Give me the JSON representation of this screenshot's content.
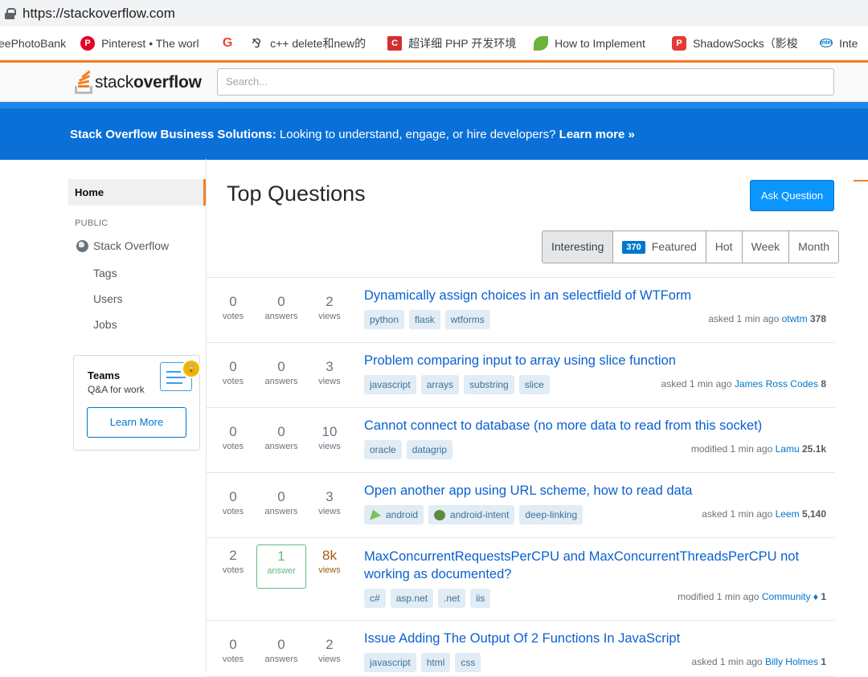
{
  "browser": {
    "url": "https://stackoverflow.com",
    "bookmarks": [
      {
        "icon": "photobank-icon",
        "label": "eePhotoBank",
        "width": 80
      },
      {
        "icon": "pinterest-icon",
        "label": "Pinterest • The worl",
        "width": 130
      },
      {
        "icon": "google-icon",
        "label": "",
        "width": 0
      },
      {
        "icon": "cpp-icon",
        "label": "c++ delete和new的",
        "width": 128
      },
      {
        "icon": "csdn-icon",
        "label": "超详细 PHP 开发环境",
        "width": 138
      },
      {
        "icon": "leaf-icon",
        "label": "How to Implement",
        "width": 128
      },
      {
        "icon": "p-icon",
        "label": "ShadowSocks（影梭",
        "width": 140
      },
      {
        "icon": "intel-icon",
        "label": "Inte",
        "width": 30
      }
    ]
  },
  "header": {
    "logo_text_light": "stack",
    "logo_text_bold": "overflow",
    "search_placeholder": "Search..."
  },
  "banner": {
    "bold": "Stack Overflow Business Solutions:",
    "text": " Looking to understand, engage, or hire developers? ",
    "link": "Learn more »"
  },
  "leftnav": {
    "home": "Home",
    "public": "PUBLIC",
    "stack_overflow": "Stack Overflow",
    "tags": "Tags",
    "users": "Users",
    "jobs": "Jobs"
  },
  "teams": {
    "title": "Teams",
    "subtitle": "Q&A for work",
    "button": "Learn More"
  },
  "main": {
    "title": "Top Questions",
    "ask_button": "Ask Question",
    "filters": {
      "interesting": "Interesting",
      "featured_count": "370",
      "featured": "Featured",
      "hot": "Hot",
      "week": "Week",
      "month": "Month"
    }
  },
  "questions": [
    {
      "votes": "0",
      "answers": "0",
      "views": "2",
      "answers_label": "answers",
      "title": "Dynamically assign choices in an selectfield of WTForm",
      "tags": [
        "python",
        "flask",
        "wtforms"
      ],
      "action": "asked 1 min ago",
      "user": "otwtm",
      "rep": "378"
    },
    {
      "votes": "0",
      "answers": "0",
      "views": "3",
      "answers_label": "answers",
      "title": "Problem comparing input to array using slice function",
      "tags": [
        "javascript",
        "arrays",
        "substring",
        "slice"
      ],
      "action": "asked 1 min ago",
      "user": "James Ross Codes",
      "rep": "8"
    },
    {
      "votes": "0",
      "answers": "0",
      "views": "10",
      "answers_label": "answers",
      "title": "Cannot connect to database (no more data to read from this socket)",
      "tags": [
        "oracle",
        "datagrip"
      ],
      "action": "modified 1 min ago",
      "user": "Lamu",
      "rep": "25.1k"
    },
    {
      "votes": "0",
      "answers": "0",
      "views": "3",
      "answers_label": "answers",
      "title": "Open another app using URL scheme, how to read data",
      "tags": [
        "android",
        "android-intent",
        "deep-linking"
      ],
      "action": "asked 1 min ago",
      "user": "Leem",
      "rep": "5,140"
    },
    {
      "votes": "2",
      "answers": "1",
      "views": "8k",
      "answers_label": "answer",
      "title": "MaxConcurrentRequestsPerCPU and MaxConcurrentThreadsPerCPU not working as documented?",
      "tags": [
        "c#",
        "asp.net",
        ".net",
        "iis"
      ],
      "action": "modified 1 min ago",
      "user": "Community ♦",
      "rep": "1"
    },
    {
      "votes": "0",
      "answers": "0",
      "views": "2",
      "answers_label": "answers",
      "title": "Issue Adding The Output Of 2 Functions In JavaScript",
      "tags": [
        "javascript",
        "html",
        "css"
      ],
      "action": "asked 1 min ago",
      "user": "Billy Holmes",
      "rep": "1"
    }
  ],
  "labels": {
    "votes": "votes",
    "views": "views"
  }
}
